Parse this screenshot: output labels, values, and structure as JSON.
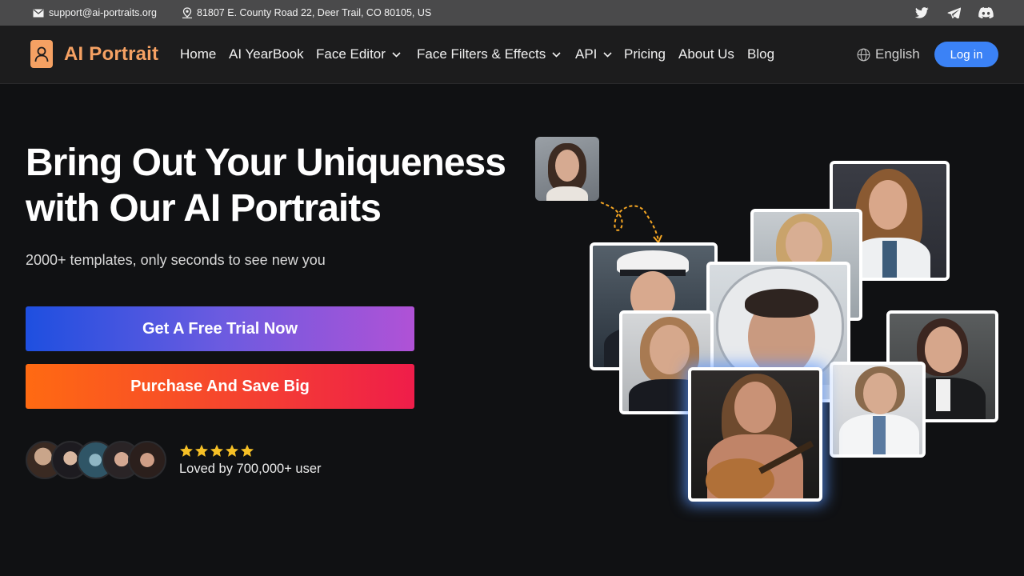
{
  "topbar": {
    "email": "support@ai-portraits.org",
    "address": "81807 E. County Road 22, Deer Trail, CO 80105, US",
    "social": [
      "twitter-icon",
      "telegram-icon",
      "discord-icon"
    ]
  },
  "navbar": {
    "logo_text": "AI Portrait",
    "links": {
      "home": "Home",
      "yearbook": "AI YearBook",
      "face_editor": "Face Editor",
      "face_filters": "Face Filters & Effects",
      "api": "API",
      "pricing": "Pricing",
      "about": "About Us",
      "blog": "Blog"
    },
    "language": "English",
    "login": "Log in"
  },
  "hero": {
    "title_line1": "Bring Out Your Uniqueness",
    "title_line2": "with Our AI Portraits",
    "subtitle": "2000+ templates, only seconds to see new you",
    "trial_button": "Get A Free Trial Now",
    "purchase_button": "Purchase And Save Big",
    "rating_stars": 5,
    "loved_text": "Loved by 700,000+ user"
  },
  "colors": {
    "brand": "#f5a163",
    "login": "#3b82f6",
    "star": "#f6c026",
    "arrow": "#f5a623"
  }
}
